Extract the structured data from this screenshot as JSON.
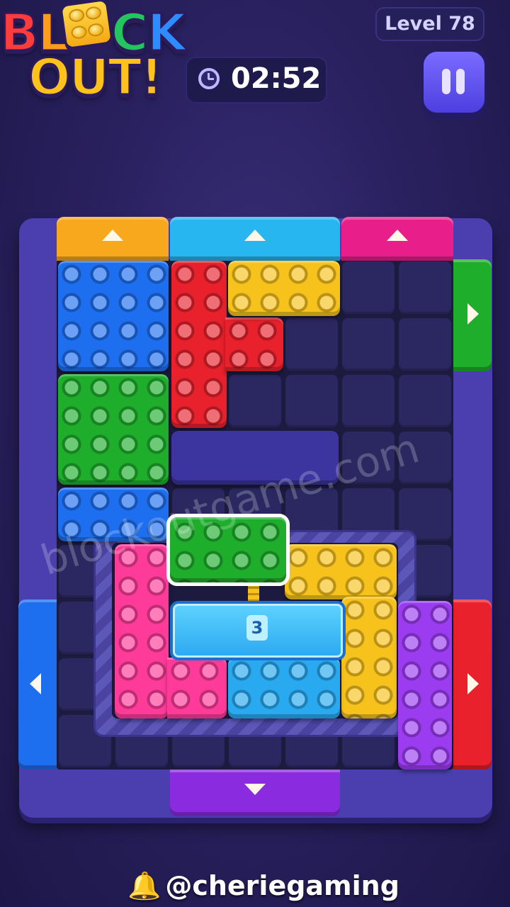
{
  "header": {
    "logo_line1": "BLOCK",
    "logo_line2": "OUT!",
    "level_label": "Level 78",
    "timer": "02:52",
    "pause_icon": "pause-icon"
  },
  "board": {
    "gates": [
      {
        "side": "top",
        "color": "#f7a81c",
        "direction": "up"
      },
      {
        "side": "top",
        "color": "#28b6f0",
        "direction": "up"
      },
      {
        "side": "top",
        "color": "#e81f8a",
        "direction": "up"
      },
      {
        "side": "right",
        "color": "#1fae2c",
        "direction": "right"
      },
      {
        "side": "right",
        "color": "#e8212c",
        "direction": "right"
      },
      {
        "side": "left",
        "color": "#1e6ff0",
        "direction": "left"
      },
      {
        "side": "bottom",
        "color": "#8a2be0",
        "direction": "down"
      }
    ],
    "blocks": [
      "blue",
      "red",
      "yellow",
      "green",
      "blue",
      "green",
      "pink",
      "yellow",
      "cyan",
      "purple"
    ],
    "key_lock_count": "3"
  },
  "watermark": "blockoutgame.com",
  "footer": {
    "handle": "@cheriegaming",
    "bell_icon": "bell-icon"
  },
  "colors": {
    "background": "#2a2160",
    "board": "#4b3fb0",
    "accent": "#7a6cff"
  }
}
